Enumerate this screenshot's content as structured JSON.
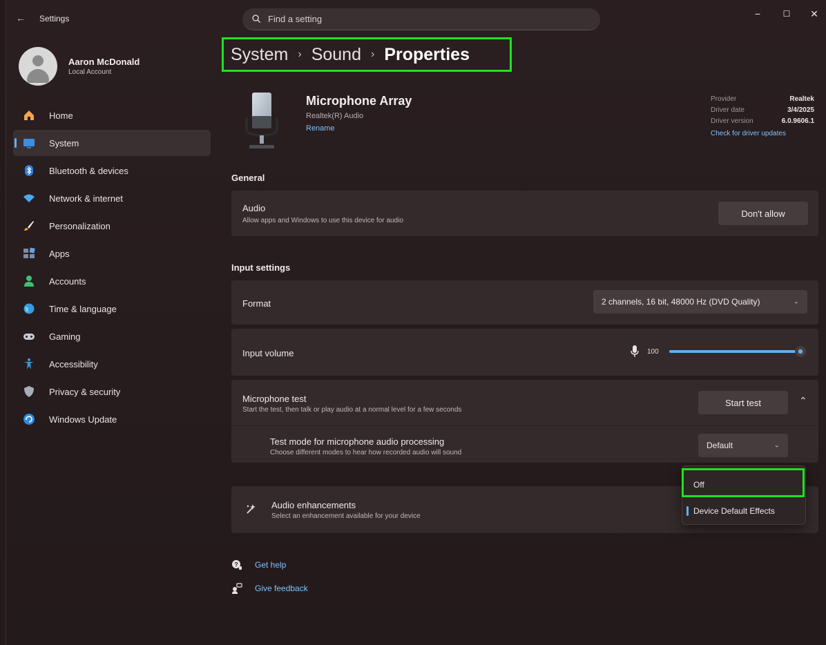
{
  "app": {
    "title": "Settings",
    "back_glyph": "←"
  },
  "search": {
    "placeholder": "Find a setting"
  },
  "window_controls": {
    "minimize": "−",
    "maximize": "☐",
    "close": "✕"
  },
  "profile": {
    "name": "Aaron McDonald",
    "subtitle": "Local Account"
  },
  "nav": {
    "items": [
      {
        "label": "Home",
        "icon": "home-icon"
      },
      {
        "label": "System",
        "icon": "system-icon",
        "active": true
      },
      {
        "label": "Bluetooth & devices",
        "icon": "bluetooth-icon"
      },
      {
        "label": "Network & internet",
        "icon": "wifi-icon"
      },
      {
        "label": "Personalization",
        "icon": "brush-icon"
      },
      {
        "label": "Apps",
        "icon": "apps-icon"
      },
      {
        "label": "Accounts",
        "icon": "accounts-icon"
      },
      {
        "label": "Time & language",
        "icon": "globe-icon"
      },
      {
        "label": "Gaming",
        "icon": "gamepad-icon"
      },
      {
        "label": "Accessibility",
        "icon": "accessibility-icon"
      },
      {
        "label": "Privacy & security",
        "icon": "shield-icon"
      },
      {
        "label": "Windows Update",
        "icon": "update-icon"
      }
    ]
  },
  "breadcrumb": {
    "items": [
      "System",
      "Sound",
      "Properties"
    ],
    "separator": "›"
  },
  "device": {
    "name": "Microphone Array",
    "driver": "Realtek(R) Audio",
    "rename_label": "Rename",
    "info": [
      {
        "key": "Provider",
        "value": "Realtek"
      },
      {
        "key": "Driver date",
        "value": "3/4/2025"
      },
      {
        "key": "Driver version",
        "value": "6.0.9606.1"
      }
    ],
    "update_link": "Check for driver updates"
  },
  "general": {
    "title": "General",
    "audio": {
      "title": "Audio",
      "subtitle": "Allow apps and Windows to use this device for audio",
      "button": "Don't allow"
    }
  },
  "input": {
    "title": "Input settings",
    "format": {
      "label": "Format",
      "value": "2 channels, 16 bit, 48000 Hz (DVD Quality)"
    },
    "volume": {
      "label": "Input volume",
      "value": "100",
      "level_percent": 100
    },
    "mic_test": {
      "title": "Microphone test",
      "subtitle": "Start the test, then talk or play audio at a normal level for a few seconds",
      "button": "Start test"
    },
    "test_mode": {
      "title": "Test mode for microphone audio processing",
      "subtitle": "Choose different modes to hear how recorded audio will sound",
      "value": "Default"
    }
  },
  "enhancements": {
    "title": "Audio enhancements",
    "subtitle": "Select an enhancement available for your device",
    "options": [
      "Off",
      "Device Default Effects"
    ],
    "selected_index": 1
  },
  "help": {
    "get_help": "Get help",
    "give_feedback": "Give feedback"
  },
  "colors": {
    "accent": "#5fb2f2",
    "highlight": "#1ee31e",
    "link": "#7dc3ff"
  }
}
